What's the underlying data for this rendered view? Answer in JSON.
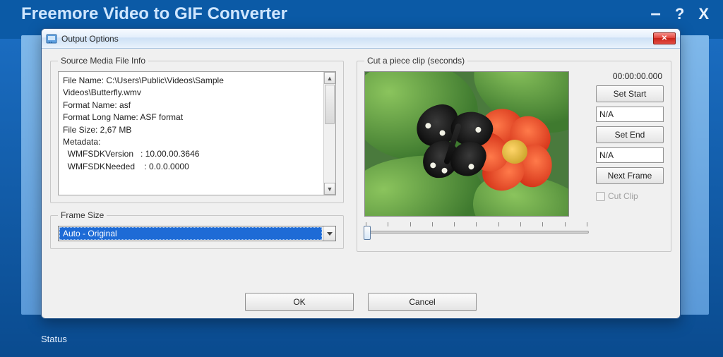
{
  "main": {
    "title": "Freemore Video to GIF Converter",
    "status_label": "Status"
  },
  "dialog": {
    "title": "Output Options",
    "source_legend": "Source Media File Info",
    "file_info": "File Name: C:\\Users\\Public\\Videos\\Sample\nVideos\\Butterfly.wmv\nFormat Name: asf\nFormat Long Name: ASF format\nFile Size: 2,67 MB\nMetadata:\n  WMFSDKVersion   : 10.00.00.3646\n  WMFSDKNeeded    : 0.0.0.0000",
    "frame_size_legend": "Frame Size",
    "frame_size_value": "Auto - Original",
    "cut_legend": "Cut a piece clip (seconds)",
    "timecode": "00:00:00.000",
    "set_start": "Set Start",
    "start_value": "N/A",
    "set_end": "Set End",
    "end_value": "N/A",
    "next_frame": "Next Frame",
    "cut_clip": "Cut Clip",
    "ok": "OK",
    "cancel": "Cancel"
  }
}
